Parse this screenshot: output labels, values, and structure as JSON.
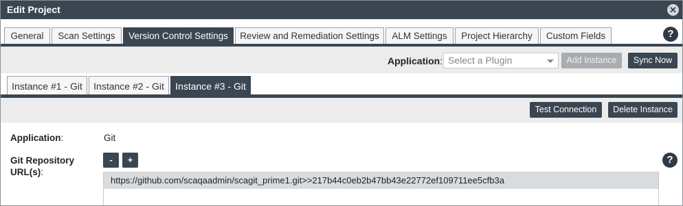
{
  "dialog": {
    "title": "Edit Project",
    "close_icon": "close-icon"
  },
  "tabs": [
    {
      "label": "General",
      "active": false
    },
    {
      "label": "Scan Settings",
      "active": false
    },
    {
      "label": "Version Control Settings",
      "active": true
    },
    {
      "label": "Review and Remediation Settings",
      "active": false
    },
    {
      "label": "ALM Settings",
      "active": false
    },
    {
      "label": "Project Hierarchy",
      "active": false
    },
    {
      "label": "Custom Fields",
      "active": false
    }
  ],
  "help_label": "?",
  "toolbar": {
    "application_label": "Application",
    "application_colon": ":",
    "select_placeholder": "Select a Plugin",
    "add_instance_label": "Add Instance",
    "sync_now_label": "Sync Now"
  },
  "instance_tabs": [
    {
      "label": "Instance #1 - Git",
      "active": false
    },
    {
      "label": "Instance #2 - Git",
      "active": false
    },
    {
      "label": "Instance #3 - Git",
      "active": true
    }
  ],
  "actions": {
    "test_connection_label": "Test Connection",
    "delete_instance_label": "Delete Instance"
  },
  "form": {
    "application_label": "Application",
    "application_colon": ":",
    "application_value": "Git",
    "repo_label_line1": "Git Repository",
    "repo_label_line2": "URL(s)",
    "repo_colon": ":",
    "minus_label": "-",
    "plus_label": "+",
    "urls": [
      "https://github.com/scaqaadmin/scagit_prime1.git>>217b44c0eb2b47bb43e22772ef109711ee5cfb3a"
    ]
  },
  "colors": {
    "header_bg": "#3a4651",
    "toolbar_bg": "#ececec",
    "disabled_button": "#a9adb1",
    "url_row_bg": "#d9dcdf"
  }
}
